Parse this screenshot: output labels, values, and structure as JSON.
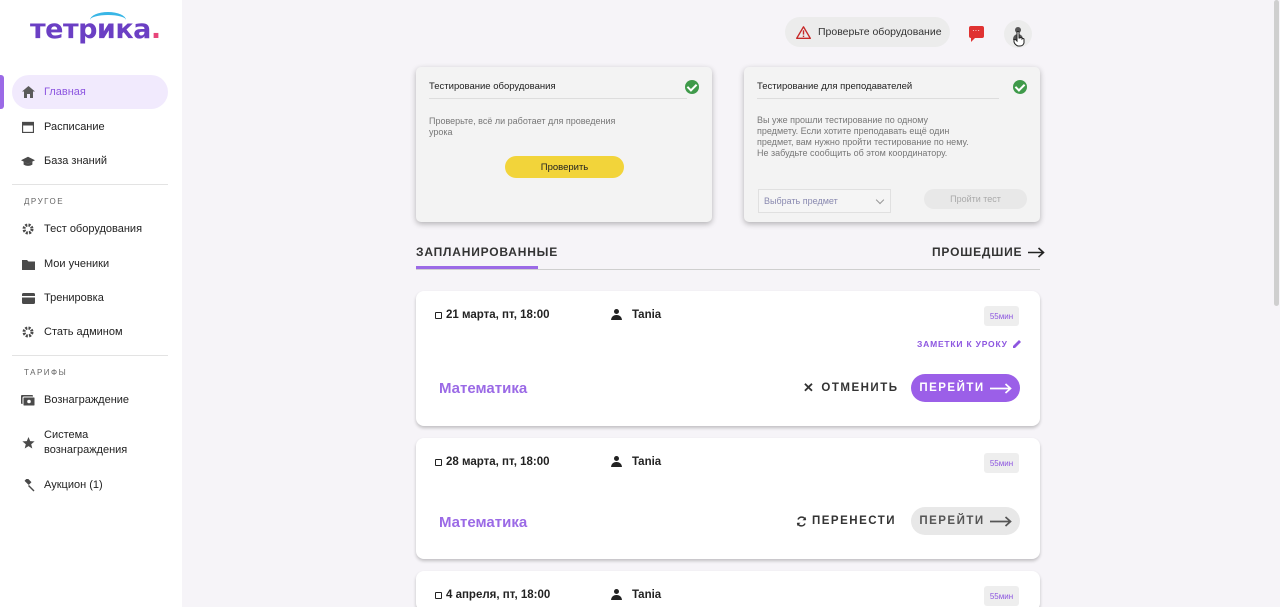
{
  "brand": {
    "logo_text": "тетрика",
    "logo_dot": ".",
    "colors": {
      "accent": "#9b6ae6",
      "yellow": "#f2d43a",
      "success": "#3f9a4a",
      "alert": "#e03232"
    }
  },
  "sidebar": {
    "items": [
      {
        "label": "Главная",
        "icon": "home-icon",
        "active": true
      },
      {
        "label": "Расписание",
        "icon": "calendar-icon"
      },
      {
        "label": "База знаний",
        "icon": "graduation-cap-icon"
      }
    ],
    "section_other": "ДРУГОЕ",
    "other_items": [
      {
        "label": "Тест оборудования",
        "icon": "gear-icon"
      },
      {
        "label": "Мои ученики",
        "icon": "folder-icon"
      },
      {
        "label": "Тренировка",
        "icon": "card-icon"
      },
      {
        "label": "Стать админом",
        "icon": "gear-icon"
      }
    ],
    "section_tariffs": "ТАРИФЫ",
    "tariff_items": [
      {
        "label": "Вознаграждение",
        "icon": "money-icon"
      },
      {
        "label": "Система вознаграждения",
        "icon": "star-icon"
      },
      {
        "label": "Аукцион (1)",
        "icon": "gavel-icon"
      }
    ]
  },
  "header": {
    "check_equipment": "Проверьте оборудование"
  },
  "equipment_test": {
    "title": "Тестирование оборудования",
    "description": "Проверьте, всё ли работает для проведения урока",
    "button": "Проверить"
  },
  "teacher_test": {
    "title": "Тестирование для преподавателей",
    "description": "Вы уже прошли тестирование по одному предмету. Если хотите преподавать ещё один предмет, вам нужно пройти тестирование по нему. Не забудьте сообщить об этом координатору.",
    "select_placeholder": "Выбрать предмет",
    "button": "Пройти тест"
  },
  "tabs": {
    "planned": "ЗАПЛАНИРОВАННЫЕ",
    "past": "ПРОШЕДШИЕ"
  },
  "lessons": [
    {
      "date": "21 марта, пт, 18:00",
      "student": "Tania",
      "duration": "55мин",
      "notes": "ЗАМЕТКИ К УРОКУ",
      "subject": "Математика",
      "action": "ОТМЕНИТЬ",
      "go": "ПЕРЕЙТИ"
    },
    {
      "date": "28 марта, пт, 18:00",
      "student": "Tania",
      "duration": "55мин",
      "subject": "Математика",
      "action": "ПЕРЕНЕСТИ",
      "go": "ПЕРЕЙТИ"
    },
    {
      "date": "4 апреля, пт, 18:00",
      "student": "Tania",
      "duration": "55мин"
    }
  ]
}
